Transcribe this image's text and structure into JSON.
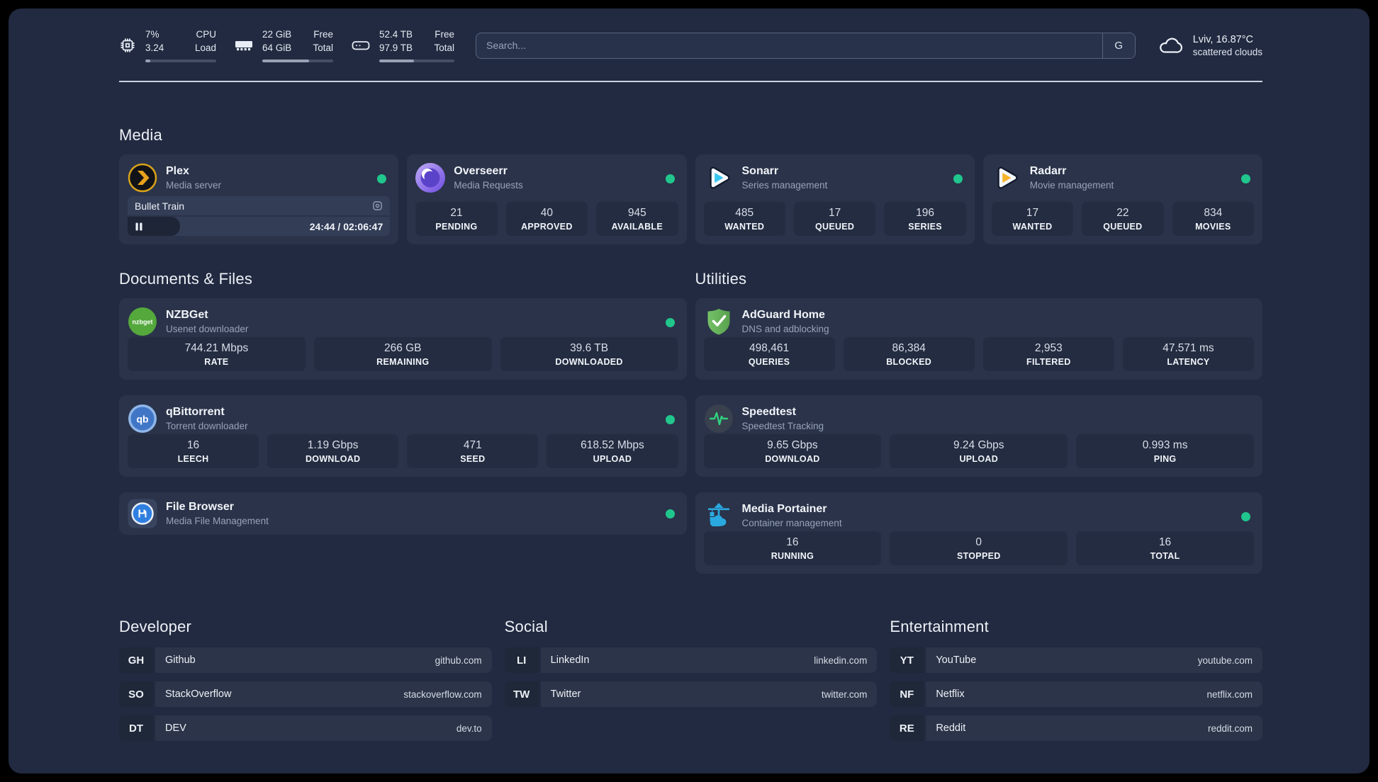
{
  "colors": {
    "online_dot": "#21c68d",
    "accent_plex": "#e5a00d",
    "accent_sonarr": "#35c5f1",
    "accent_radarr": "#f6b42a",
    "accent_adguard": "#68bc4f",
    "accent_portainer": "#2aa9e0",
    "accent_speedtest": "#2fd17f"
  },
  "header": {
    "stats": [
      {
        "icon": "cpu",
        "value_top": "7%",
        "value_bottom": "3.24",
        "label_top": "CPU",
        "label_bottom": "Load",
        "progress_pct": 7
      },
      {
        "icon": "memory",
        "value_top": "22 GiB",
        "value_bottom": "64 GiB",
        "label_top": "Free",
        "label_bottom": "Total",
        "progress_pct": 66
      },
      {
        "icon": "disk",
        "value_top": "52.4 TB",
        "value_bottom": "97.9 TB",
        "label_top": "Free",
        "label_bottom": "Total",
        "progress_pct": 46
      }
    ],
    "search": {
      "placeholder": "Search...",
      "engine_button": "G"
    },
    "weather": {
      "location_temp": "Lviv, 16.87°C",
      "condition": "scattered clouds"
    }
  },
  "sections": {
    "media": {
      "title": "Media",
      "cards": [
        {
          "name": "Plex",
          "description": "Media server",
          "online": true,
          "now_playing": {
            "title": "Bullet Train",
            "time": "24:44 / 02:06:47",
            "progress_pct": 20
          }
        },
        {
          "name": "Overseerr",
          "description": "Media Requests",
          "online": true,
          "stats": [
            {
              "value": "21",
              "label": "PENDING"
            },
            {
              "value": "40",
              "label": "APPROVED"
            },
            {
              "value": "945",
              "label": "AVAILABLE"
            }
          ]
        },
        {
          "name": "Sonarr",
          "description": "Series management",
          "online": true,
          "stats": [
            {
              "value": "485",
              "label": "WANTED"
            },
            {
              "value": "17",
              "label": "QUEUED"
            },
            {
              "value": "196",
              "label": "SERIES"
            }
          ]
        },
        {
          "name": "Radarr",
          "description": "Movie management",
          "online": true,
          "stats": [
            {
              "value": "17",
              "label": "WANTED"
            },
            {
              "value": "22",
              "label": "QUEUED"
            },
            {
              "value": "834",
              "label": "MOVIES"
            }
          ]
        }
      ]
    },
    "documents": {
      "title": "Documents & Files",
      "cards": [
        {
          "name": "NZBGet",
          "description": "Usenet downloader",
          "online": true,
          "icon_label": "nzbget",
          "stats": [
            {
              "value": "744.21 Mbps",
              "label": "RATE"
            },
            {
              "value": "266 GB",
              "label": "REMAINING"
            },
            {
              "value": "39.6 TB",
              "label": "DOWNLOADED"
            }
          ]
        },
        {
          "name": "qBittorrent",
          "description": "Torrent downloader",
          "online": true,
          "icon_label": "qb",
          "stats": [
            {
              "value": "16",
              "label": "LEECH"
            },
            {
              "value": "1.19 Gbps",
              "label": "DOWNLOAD"
            },
            {
              "value": "471",
              "label": "SEED"
            },
            {
              "value": "618.52 Mbps",
              "label": "UPLOAD"
            }
          ]
        },
        {
          "name": "File Browser",
          "description": "Media File Management",
          "online": true,
          "stats": []
        }
      ]
    },
    "utilities": {
      "title": "Utilities",
      "cards": [
        {
          "name": "AdGuard Home",
          "description": "DNS and adblocking",
          "online": false,
          "stats": [
            {
              "value": "498,461",
              "label": "QUERIES"
            },
            {
              "value": "86,384",
              "label": "BLOCKED"
            },
            {
              "value": "2,953",
              "label": "FILTERED"
            },
            {
              "value": "47.571 ms",
              "label": "LATENCY"
            }
          ]
        },
        {
          "name": "Speedtest",
          "description": "Speedtest Tracking",
          "online": false,
          "stats": [
            {
              "value": "9.65 Gbps",
              "label": "DOWNLOAD"
            },
            {
              "value": "9.24 Gbps",
              "label": "UPLOAD"
            },
            {
              "value": "0.993 ms",
              "label": "PING"
            }
          ]
        },
        {
          "name": "Media Portainer",
          "description": "Container management",
          "online": true,
          "stats": [
            {
              "value": "16",
              "label": "RUNNING"
            },
            {
              "value": "0",
              "label": "STOPPED"
            },
            {
              "value": "16",
              "label": "TOTAL"
            }
          ]
        }
      ]
    },
    "bookmarks": [
      {
        "title": "Developer",
        "links": [
          {
            "abbr": "GH",
            "name": "Github",
            "url": "github.com"
          },
          {
            "abbr": "SO",
            "name": "StackOverflow",
            "url": "stackoverflow.com"
          },
          {
            "abbr": "DT",
            "name": "DEV",
            "url": "dev.to"
          }
        ]
      },
      {
        "title": "Social",
        "links": [
          {
            "abbr": "LI",
            "name": "LinkedIn",
            "url": "linkedin.com"
          },
          {
            "abbr": "TW",
            "name": "Twitter",
            "url": "twitter.com"
          }
        ]
      },
      {
        "title": "Entertainment",
        "links": [
          {
            "abbr": "YT",
            "name": "YouTube",
            "url": "youtube.com"
          },
          {
            "abbr": "NF",
            "name": "Netflix",
            "url": "netflix.com"
          },
          {
            "abbr": "RE",
            "name": "Reddit",
            "url": "reddit.com"
          }
        ]
      }
    ]
  }
}
